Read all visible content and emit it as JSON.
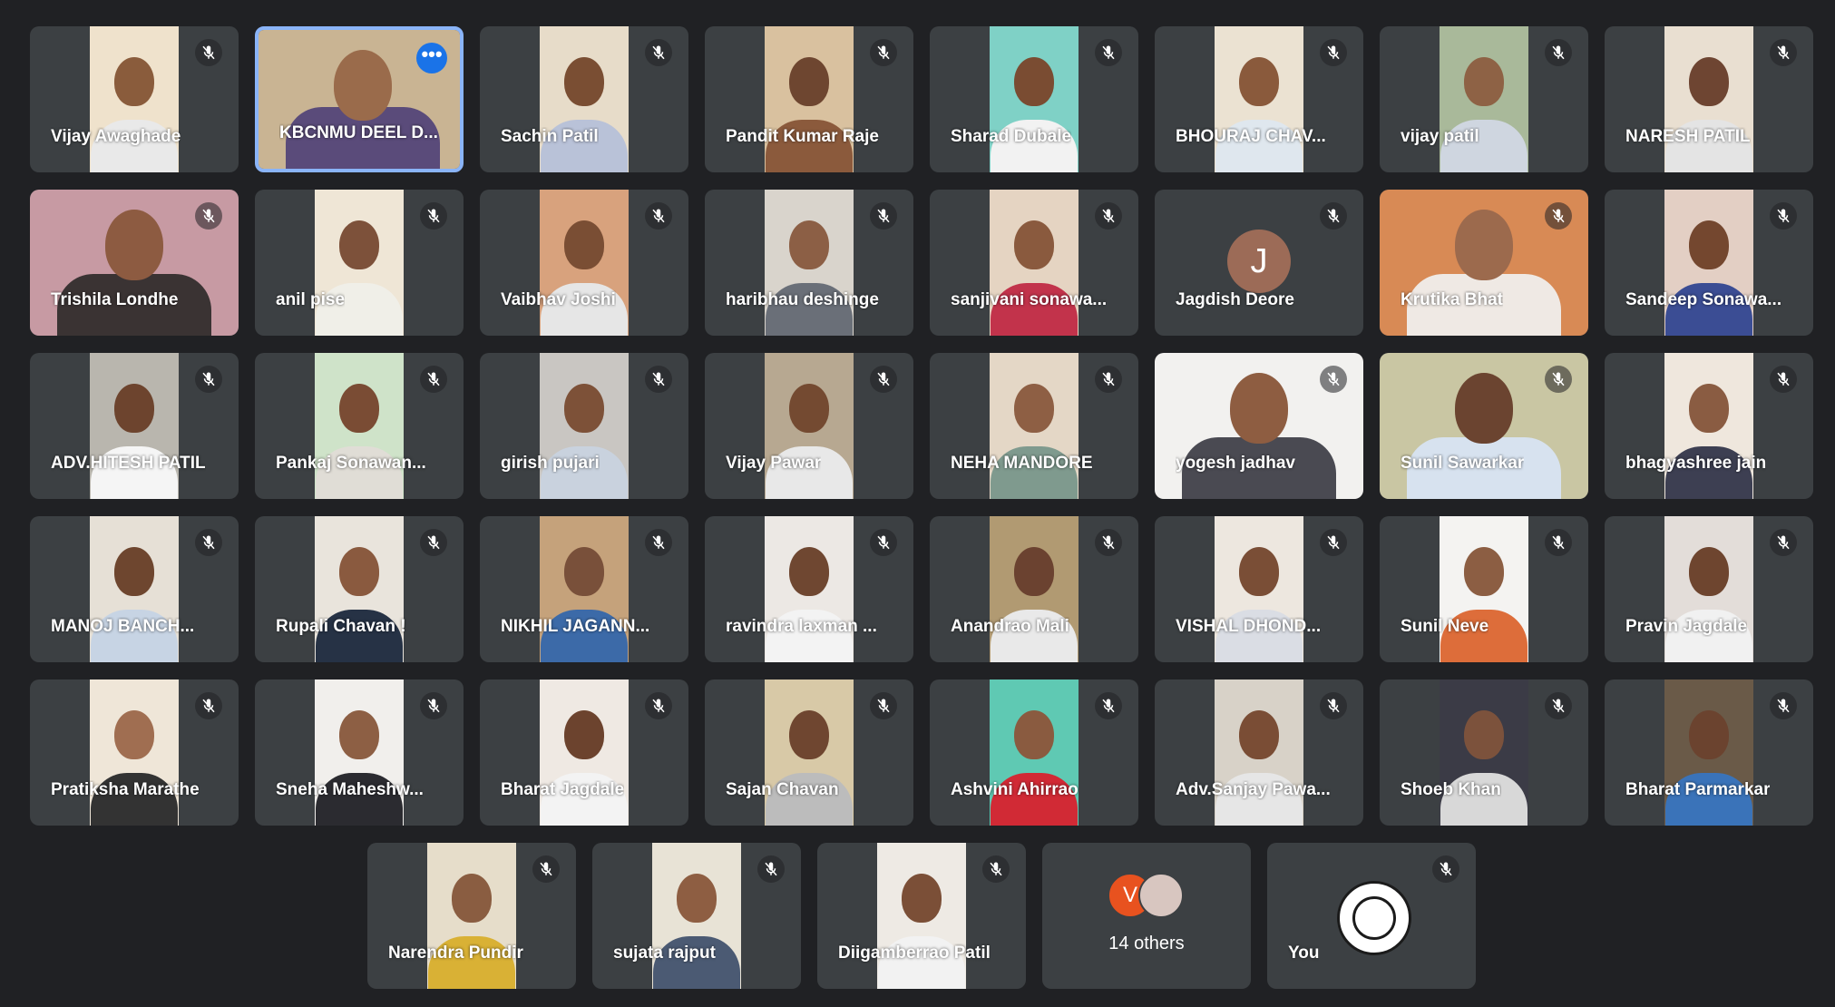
{
  "participants": [
    {
      "name": "Vijay Awaghade",
      "video": "portrait",
      "bg": "#efe2cc",
      "skin": "#8a5c3c",
      "shirt": "#e9e9e9"
    },
    {
      "name": "KBCNMU DEEL D...",
      "video": "wide",
      "bg": "#c9b493",
      "skin": "#9a6b4b",
      "shirt": "#5a4b7a",
      "active": true,
      "more": true
    },
    {
      "name": "Sachin Patil",
      "video": "portrait",
      "bg": "#e7dcc9",
      "skin": "#7a4e33",
      "shirt": "#b9c2d8"
    },
    {
      "name": "Pandit Kumar Raje",
      "video": "portrait",
      "bg": "#d9c19f",
      "skin": "#6e4630",
      "shirt": "#8b5a3c"
    },
    {
      "name": "Sharad Dubale",
      "video": "portrait",
      "bg": "#7fd1c6",
      "skin": "#7a4c32",
      "shirt": "#f2f2f2"
    },
    {
      "name": "BHOURAJ CHAV...",
      "video": "portrait",
      "bg": "#ebe2d2",
      "skin": "#8a5a3c",
      "shirt": "#dfe7ee"
    },
    {
      "name": "vijay patil",
      "video": "portrait",
      "bg": "#a9b99a",
      "skin": "#8e6245",
      "shirt": "#cfd6e0"
    },
    {
      "name": "NARESH PATIL",
      "video": "portrait",
      "bg": "#e9dfd1",
      "skin": "#6e4532",
      "shirt": "#e4e4e4"
    },
    {
      "name": "Trishila Londhe",
      "video": "wide",
      "bg": "#c79aa3",
      "skin": "#8d5b41",
      "shirt": "#3a3333"
    },
    {
      "name": "anil pise",
      "video": "portrait",
      "bg": "#efe6d6",
      "skin": "#7d513a",
      "shirt": "#f0efe8"
    },
    {
      "name": "Vaibhav Joshi",
      "video": "portrait",
      "bg": "#d8a27d",
      "skin": "#7a4e34",
      "shirt": "#e6e6e6"
    },
    {
      "name": "haribhau deshinge",
      "video": "portrait",
      "bg": "#d9d4cc",
      "skin": "#8c5f45",
      "shirt": "#6a6f78"
    },
    {
      "name": "sanjivani sonawa...",
      "video": "portrait",
      "bg": "#e5d4c2",
      "skin": "#8a5a3e",
      "shirt": "#c2334b"
    },
    {
      "name": "Jagdish Deore",
      "video": "avatar",
      "letter": "J"
    },
    {
      "name": "Krutika Bhat",
      "video": "wide",
      "bg": "#d88a55",
      "skin": "#9c6a4d",
      "shirt": "#efe9e4"
    },
    {
      "name": "Sandeep Sonawa...",
      "video": "portrait",
      "bg": "#e3cfc4",
      "skin": "#74472f",
      "shirt": "#3b4d94"
    },
    {
      "name": "ADV.HITESH PATIL",
      "video": "portrait",
      "bg": "#b9b6ae",
      "skin": "#6d442e",
      "shirt": "#f5f5f5"
    },
    {
      "name": "Pankaj Sonawan...",
      "video": "portrait",
      "bg": "#cfe3c9",
      "skin": "#7a4c34",
      "shirt": "#e0ddd6"
    },
    {
      "name": "girish pujari",
      "video": "portrait",
      "bg": "#c9c6c2",
      "skin": "#7d5138",
      "shirt": "#c9d2de"
    },
    {
      "name": "Vijay Pawar",
      "video": "portrait",
      "bg": "#b7a891",
      "skin": "#744a31",
      "shirt": "#e8e8e8"
    },
    {
      "name": "NEHA MANDORE",
      "video": "portrait",
      "bg": "#e4d7c6",
      "skin": "#8e5f44",
      "shirt": "#7f9a8e"
    },
    {
      "name": "yogesh jadhav",
      "video": "wide",
      "bg": "#f2f1ef",
      "skin": "#8e5d41",
      "shirt": "#4a4a52"
    },
    {
      "name": "Sunil Sawarkar",
      "video": "wide",
      "bg": "#c9c6a3",
      "skin": "#6b4430",
      "shirt": "#d7e2ef"
    },
    {
      "name": "bhagyashree jain",
      "video": "portrait",
      "bg": "#efe7dd",
      "skin": "#8a5c42",
      "shirt": "#3d3f52"
    },
    {
      "name": "MANOJ BANCH...",
      "video": "portrait",
      "bg": "#e6e0d6",
      "skin": "#6e462f",
      "shirt": "#c7d4e4"
    },
    {
      "name": "Rupali Chavan !",
      "video": "portrait",
      "bg": "#e9e4dc",
      "skin": "#8a5a3f",
      "shirt": "#263245"
    },
    {
      "name": "NIKHIL JAGANN...",
      "video": "portrait",
      "bg": "#c5a27b",
      "skin": "#79503a",
      "shirt": "#3c6aa8"
    },
    {
      "name": "ravindra laxman ...",
      "video": "portrait",
      "bg": "#ece8e4",
      "skin": "#6f4731",
      "shirt": "#f3f3f3"
    },
    {
      "name": "Anandrao Mali",
      "video": "portrait",
      "bg": "#b19a72",
      "skin": "#6b4230",
      "shirt": "#e9e9e9"
    },
    {
      "name": "VISHAL DHOND...",
      "video": "portrait",
      "bg": "#ede7df",
      "skin": "#7a4e36",
      "shirt": "#dadde4"
    },
    {
      "name": "Sunil Neve",
      "video": "portrait",
      "bg": "#f4f3f1",
      "skin": "#8c5e43",
      "shirt": "#dd6d3a"
    },
    {
      "name": "Pravin Jagdale",
      "video": "portrait",
      "bg": "#e3ddd9",
      "skin": "#6e452f",
      "shirt": "#f1f1f1"
    },
    {
      "name": "Pratiksha Marathe",
      "video": "portrait",
      "bg": "#efe6d8",
      "skin": "#a06e51",
      "shirt": "#333333"
    },
    {
      "name": "Sneha Maheshw...",
      "video": "portrait",
      "bg": "#f1efec",
      "skin": "#8d5f44",
      "shirt": "#2b2b30"
    },
    {
      "name": "Bharat Jagdale",
      "video": "portrait",
      "bg": "#efe9e3",
      "skin": "#6c432e",
      "shirt": "#f3f3f3"
    },
    {
      "name": "Sajan Chavan",
      "video": "portrait",
      "bg": "#d8c9a7",
      "skin": "#6f4630",
      "shirt": "#bcbcbc"
    },
    {
      "name": "Ashvini Ahirrao",
      "video": "portrait",
      "bg": "#5fc9b3",
      "skin": "#8a5b40",
      "shirt": "#d12a35"
    },
    {
      "name": "Adv.Sanjay Pawa...",
      "video": "portrait",
      "bg": "#d8d2c8",
      "skin": "#7a4d35",
      "shirt": "#e6e6e6"
    },
    {
      "name": "Shoeb Khan",
      "video": "portrait",
      "bg": "#3b3b46",
      "skin": "#7c523c",
      "shirt": "#d8d8d8"
    },
    {
      "name": "Bharat Parmarkar",
      "video": "portrait",
      "bg": "#6a5a48",
      "skin": "#6b432f",
      "shirt": "#3a73b9"
    },
    {
      "name": "Narendra Pundir",
      "video": "portrait",
      "bg": "#e6ddca",
      "skin": "#8a5d41",
      "shirt": "#d9b135"
    },
    {
      "name": "sujata rajput",
      "video": "portrait",
      "bg": "#e8e3d6",
      "skin": "#8e5e42",
      "shirt": "#4b5a73"
    },
    {
      "name": "Diigamberrao Patil",
      "video": "portrait",
      "bg": "#eeeae4",
      "skin": "#7b4f37",
      "shirt": "#f2f2f2"
    },
    {
      "name": "14 others",
      "video": "others",
      "avatar_letter": "V"
    },
    {
      "name": "You",
      "video": "you"
    }
  ],
  "icons": {
    "mic_off": "mic-off-icon",
    "more": "more-options-icon"
  },
  "more_label": "•••",
  "colors": {
    "background": "#202124",
    "tile": "#3c4043",
    "active_border": "#8ab4f8",
    "accent": "#1a73e8"
  }
}
